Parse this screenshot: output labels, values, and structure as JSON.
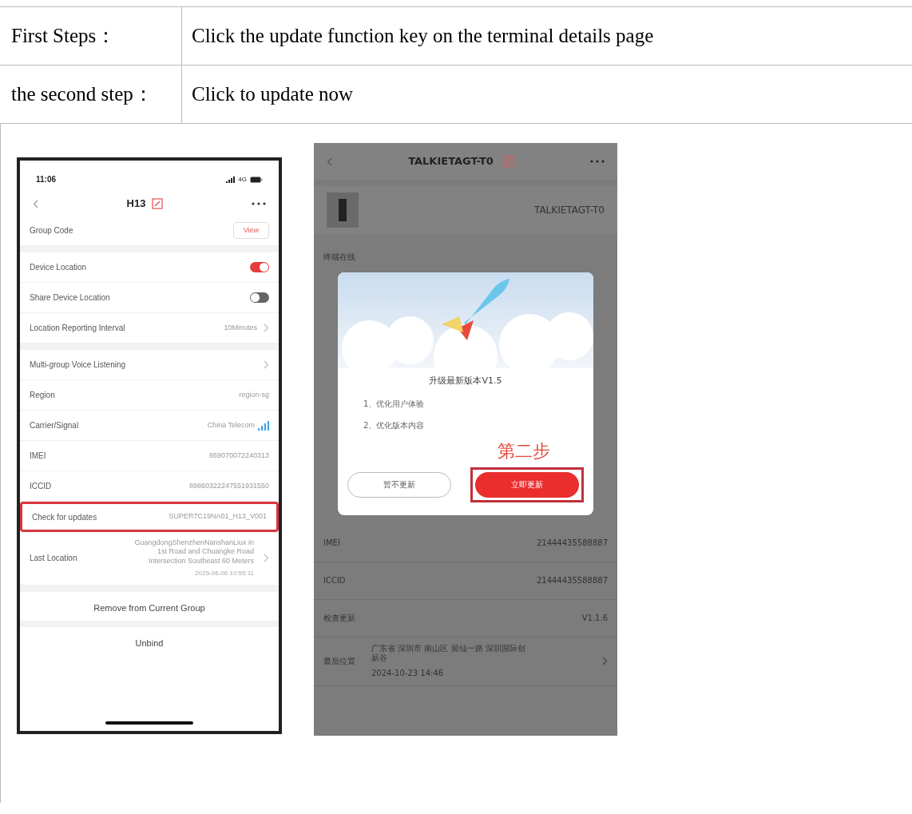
{
  "steps": [
    {
      "label": "First Steps：",
      "text": "Click the update function key on the terminal details page"
    },
    {
      "label": "the second step：",
      "text": "Click to update now"
    }
  ],
  "phone_left": {
    "time": "11:06",
    "network": "4G",
    "title": "H13",
    "sections": [
      [
        {
          "kind": "button",
          "label": "Group Code",
          "value": "View"
        }
      ],
      [
        {
          "kind": "toggle",
          "label": "Device Location",
          "on": true
        },
        {
          "kind": "toggle",
          "label": "Share Device Location",
          "on": false
        },
        {
          "kind": "link",
          "label": "Location Reporting Interval",
          "value": "10Minutes"
        }
      ],
      [
        {
          "kind": "link",
          "label": "Multi-group Voice Listening"
        },
        {
          "kind": "value",
          "label": "Region",
          "value": "region-sg"
        },
        {
          "kind": "signal",
          "label": "Carrier/Signal",
          "value": "China Telecom"
        },
        {
          "kind": "value",
          "label": "IMEI",
          "value": "869070072240313"
        },
        {
          "kind": "value",
          "label": "ICCID",
          "value": "89860322247551931550"
        },
        {
          "kind": "value",
          "label": "Check for updates",
          "value": "SUPER7C19NA01_H13_V001",
          "highlighted": true
        },
        {
          "kind": "location",
          "label": "Last Location",
          "value": "GuangdongShenzhenNanshanLiux in 1st Road and Chuangke Road Intersection Southeast 60 Meters",
          "time": "2025-06-06 10:55:11"
        }
      ]
    ],
    "actions": [
      "Remove from Current Group",
      "Unbind"
    ]
  },
  "phone_right": {
    "title": "TALKIETAGT-T0",
    "device_name": "TALKIETAGT-T0",
    "status_label": "终端在线",
    "dialog": {
      "title": "升级最新版本V1.5",
      "notes": [
        "1、优化用户体验",
        "2、优化版本内容"
      ],
      "callout": "第二步",
      "cancel": "暂不更新",
      "confirm": "立即更新"
    },
    "rows": [
      {
        "kind": "value",
        "label": "IMEI",
        "value": "21444435588887"
      },
      {
        "kind": "value",
        "label": "ICCID",
        "value": "21444435588887"
      },
      {
        "kind": "value",
        "label": "检查更新",
        "value": "V1.1.6"
      },
      {
        "kind": "location",
        "label": "最后位置",
        "value": "广东省 深圳市 南山区 留仙一路 深圳国际创新谷",
        "time": "2024-10-23 14:46"
      }
    ]
  }
}
